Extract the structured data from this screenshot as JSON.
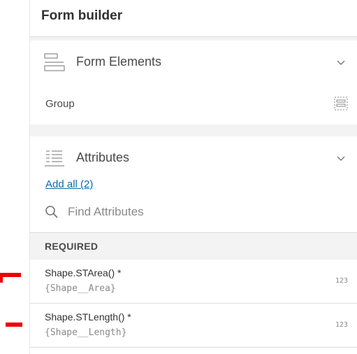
{
  "header": {
    "title": "Form builder"
  },
  "form_elements": {
    "title": "Form Elements",
    "icon": "form-elements-icon",
    "items": [
      {
        "label": "Group",
        "icon": "group-icon"
      }
    ]
  },
  "attributes": {
    "title": "Attributes",
    "icon": "attributes-icon",
    "add_all_label": "Add all (2)",
    "search_placeholder": "Find Attributes",
    "required_header": "REQUIRED",
    "items": [
      {
        "name": "Shape.STArea() *",
        "field": "{Shape__Area}",
        "type": "123"
      },
      {
        "name": "Shape.STLength() *",
        "field": "{Shape__Length}",
        "type": "123"
      }
    ]
  },
  "colors": {
    "accent_link": "#0b6ea5",
    "annotation_red": "#ee0000"
  }
}
